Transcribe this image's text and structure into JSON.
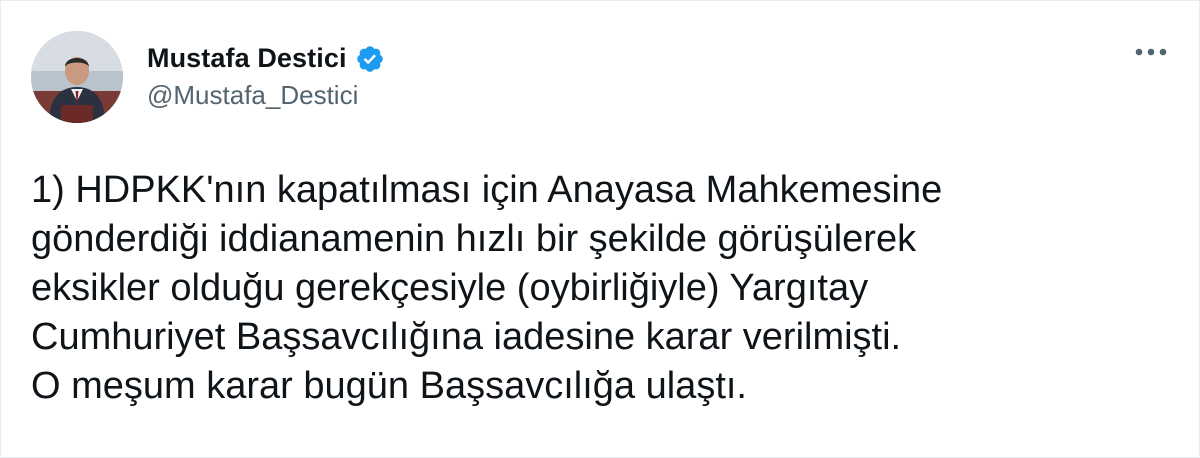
{
  "author": {
    "display_name": "Mustafa Destici",
    "handle": "@Mustafa_Destici",
    "verified_icon": "verified-badge-icon",
    "avatar_icon": "avatar"
  },
  "menu": {
    "icon": "more-horizontal-icon"
  },
  "tweet": {
    "lines": [
      "1) HDPKK'nın kapatılması için Anayasa Mahkemesine",
      "gönderdiği iddianamenin hızlı bir şekilde görüşülerek",
      "eksikler olduğu gerekçesiyle (oybirliğiyle) Yargıtay",
      "Cumhuriyet Başsavcılığına iadesine karar verilmişti.",
      "O meşum karar bugün Başsavcılığa ulaştı."
    ]
  },
  "colors": {
    "text": "#0f1419",
    "secondary": "#536471",
    "verified": "#1d9bf0"
  }
}
